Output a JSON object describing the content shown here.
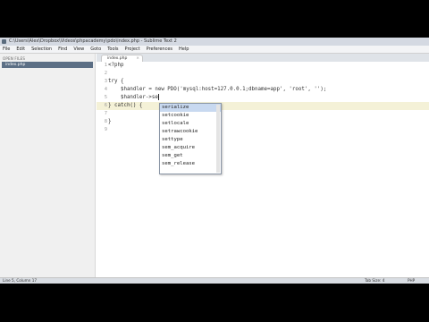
{
  "window": {
    "title": "C:\\Users\\Alex\\Dropbox\\Videos\\phpacademy\\pdo\\index.php - Sublime Text 2"
  },
  "menu": [
    "File",
    "Edit",
    "Selection",
    "Find",
    "View",
    "Goto",
    "Tools",
    "Project",
    "Preferences",
    "Help"
  ],
  "sidebar": {
    "header": "OPEN FILES",
    "files": [
      "index.php"
    ]
  },
  "tabs": [
    {
      "label": "index.php",
      "close": "×"
    }
  ],
  "editor": {
    "line_numbers": [
      "1",
      "2",
      "3",
      "4",
      "5",
      "6",
      "7",
      "8",
      "9"
    ],
    "lines": [
      "<?php",
      "",
      "try {",
      "    $handler = new PDO('mysql:host=127.0.0.1;dbname=app', 'root', '');",
      "    $handler->se",
      "} catch() {",
      "",
      "}",
      ""
    ]
  },
  "autocomplete": {
    "items": [
      "serialize",
      "setcookie",
      "setlocale",
      "setrawcookie",
      "settype",
      "sem_acquire",
      "sem_get",
      "sem_release"
    ],
    "selected_index": 0
  },
  "status": {
    "position": "Line 5, Column 17",
    "tab_size": "Tab Size: 4",
    "syntax": "PHP"
  }
}
